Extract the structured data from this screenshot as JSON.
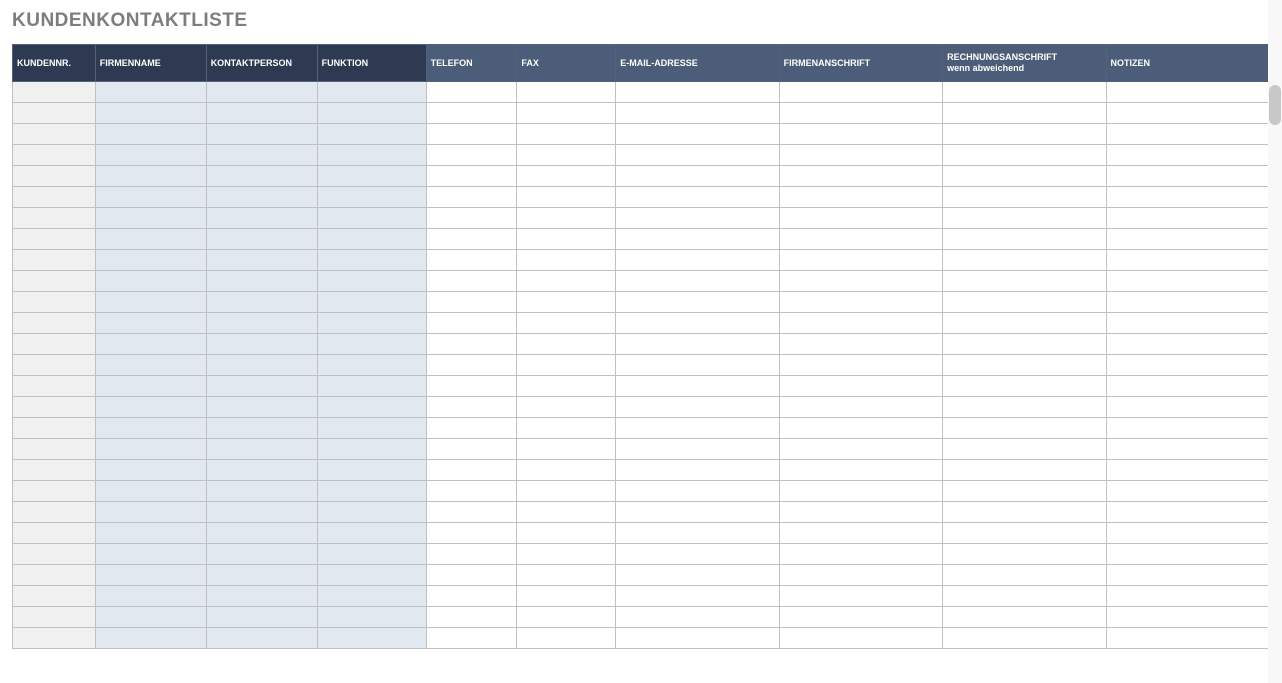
{
  "title": "KUNDENKONTAKTLISTE",
  "columns": [
    "KUNDENNR.",
    "FIRMENNAME",
    "KONTAKTPERSON",
    "FUNKTION",
    "TELEFON",
    "FAX",
    "E-MAIL-ADRESSE",
    "FIRMENANSCHRIFT",
    "RECHNUNGSANSCHRIFT\nwenn abweichend",
    "NOTIZEN"
  ],
  "rows": [
    [
      "",
      "",
      "",
      "",
      "",
      "",
      "",
      "",
      "",
      ""
    ],
    [
      "",
      "",
      "",
      "",
      "",
      "",
      "",
      "",
      "",
      ""
    ],
    [
      "",
      "",
      "",
      "",
      "",
      "",
      "",
      "",
      "",
      ""
    ],
    [
      "",
      "",
      "",
      "",
      "",
      "",
      "",
      "",
      "",
      ""
    ],
    [
      "",
      "",
      "",
      "",
      "",
      "",
      "",
      "",
      "",
      ""
    ],
    [
      "",
      "",
      "",
      "",
      "",
      "",
      "",
      "",
      "",
      ""
    ],
    [
      "",
      "",
      "",
      "",
      "",
      "",
      "",
      "",
      "",
      ""
    ],
    [
      "",
      "",
      "",
      "",
      "",
      "",
      "",
      "",
      "",
      ""
    ],
    [
      "",
      "",
      "",
      "",
      "",
      "",
      "",
      "",
      "",
      ""
    ],
    [
      "",
      "",
      "",
      "",
      "",
      "",
      "",
      "",
      "",
      ""
    ],
    [
      "",
      "",
      "",
      "",
      "",
      "",
      "",
      "",
      "",
      ""
    ],
    [
      "",
      "",
      "",
      "",
      "",
      "",
      "",
      "",
      "",
      ""
    ],
    [
      "",
      "",
      "",
      "",
      "",
      "",
      "",
      "",
      "",
      ""
    ],
    [
      "",
      "",
      "",
      "",
      "",
      "",
      "",
      "",
      "",
      ""
    ],
    [
      "",
      "",
      "",
      "",
      "",
      "",
      "",
      "",
      "",
      ""
    ],
    [
      "",
      "",
      "",
      "",
      "",
      "",
      "",
      "",
      "",
      ""
    ],
    [
      "",
      "",
      "",
      "",
      "",
      "",
      "",
      "",
      "",
      ""
    ],
    [
      "",
      "",
      "",
      "",
      "",
      "",
      "",
      "",
      "",
      ""
    ],
    [
      "",
      "",
      "",
      "",
      "",
      "",
      "",
      "",
      "",
      ""
    ],
    [
      "",
      "",
      "",
      "",
      "",
      "",
      "",
      "",
      "",
      ""
    ],
    [
      "",
      "",
      "",
      "",
      "",
      "",
      "",
      "",
      "",
      ""
    ],
    [
      "",
      "",
      "",
      "",
      "",
      "",
      "",
      "",
      "",
      ""
    ],
    [
      "",
      "",
      "",
      "",
      "",
      "",
      "",
      "",
      "",
      ""
    ],
    [
      "",
      "",
      "",
      "",
      "",
      "",
      "",
      "",
      "",
      ""
    ],
    [
      "",
      "",
      "",
      "",
      "",
      "",
      "",
      "",
      "",
      ""
    ],
    [
      "",
      "",
      "",
      "",
      "",
      "",
      "",
      "",
      "",
      ""
    ],
    [
      "",
      "",
      "",
      "",
      "",
      "",
      "",
      "",
      "",
      ""
    ]
  ]
}
